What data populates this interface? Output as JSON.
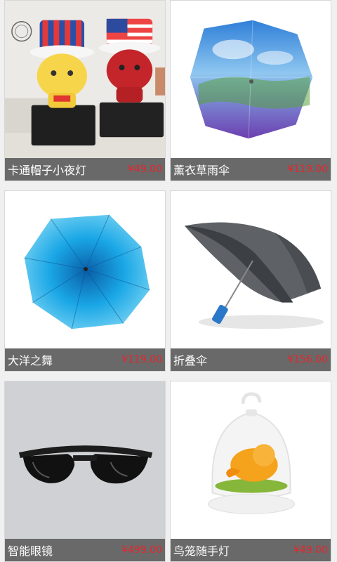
{
  "products": [
    {
      "name": "卡通帽子小夜灯",
      "price": "¥49.00",
      "image": "cartoon-hat-night-light-image"
    },
    {
      "name": "薰衣草雨伞",
      "price": "¥119.00",
      "image": "lavender-umbrella-image"
    },
    {
      "name": "大洋之舞",
      "price": "¥119.00",
      "image": "ocean-dance-umbrella-image"
    },
    {
      "name": "折叠伞",
      "price": "¥156.00",
      "image": "folding-umbrella-image"
    },
    {
      "name": "智能眼镜",
      "price": "¥499.00",
      "image": "smart-glasses-image"
    },
    {
      "name": "鸟笼随手灯",
      "price": "¥49.00",
      "image": "birdcage-lamp-image"
    }
  ],
  "colors": {
    "price": "#e8252c",
    "bar": "#5c5c5c",
    "page": "#f0f0f0"
  }
}
